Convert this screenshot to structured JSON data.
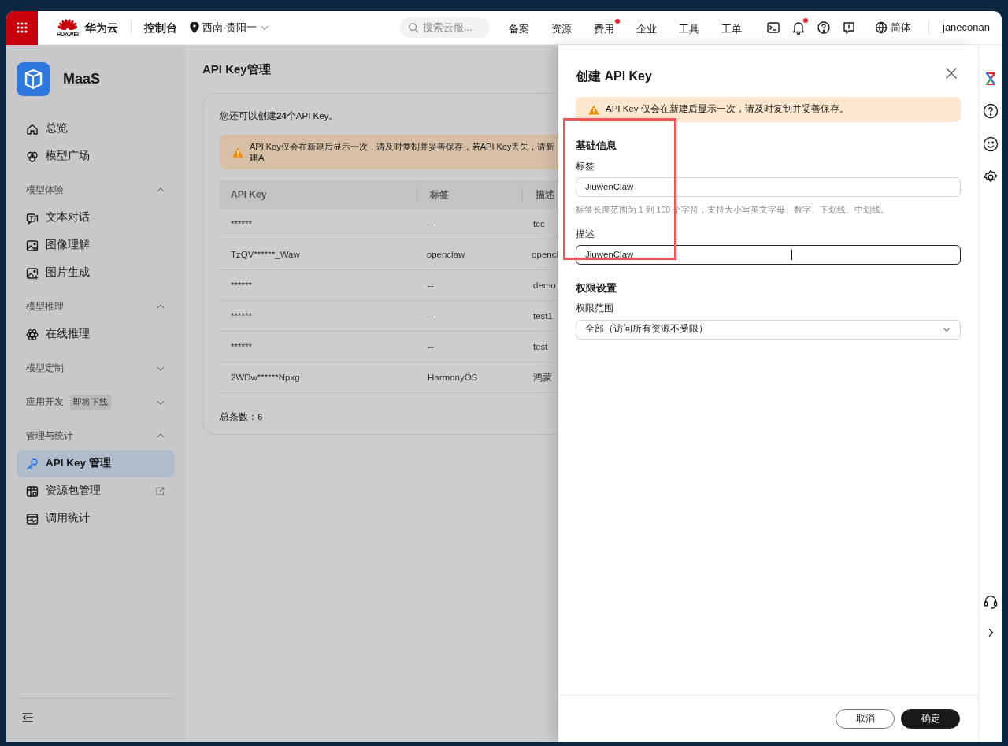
{
  "header": {
    "brand": "华为云",
    "brand_caption": "HUAWEI",
    "console": "控制台",
    "region": "西南-贵阳一",
    "search": {
      "placeholder": "搜索云服..."
    },
    "nav": [
      {
        "label": "备案",
        "dot": false
      },
      {
        "label": "资源",
        "dot": false
      },
      {
        "label": "费用",
        "dot": true
      },
      {
        "label": "企业",
        "dot": false
      },
      {
        "label": "工具",
        "dot": false
      },
      {
        "label": "工单",
        "dot": false
      }
    ],
    "icons": [
      {
        "kind": "terminal",
        "dot": false
      },
      {
        "kind": "bell",
        "dot": true
      },
      {
        "kind": "help",
        "dot": false
      },
      {
        "kind": "feedback",
        "dot": false
      }
    ],
    "language": "简体",
    "user": "janeconan"
  },
  "sidebar": {
    "product": "MaaS",
    "items": [
      {
        "label": "总览",
        "selected": false,
        "external": false
      },
      {
        "label": "模型广场",
        "selected": false,
        "external": false
      }
    ],
    "groups": [
      {
        "label": "模型体验",
        "expanded": true,
        "items": [
          {
            "label": "文本对话",
            "selected": false,
            "external": false
          },
          {
            "label": "图像理解",
            "selected": false,
            "external": false
          },
          {
            "label": "图片生成",
            "selected": false,
            "external": false
          }
        ]
      },
      {
        "label": "模型推理",
        "expanded": true,
        "items": [
          {
            "label": "在线推理",
            "selected": false,
            "external": false
          }
        ]
      },
      {
        "label": "模型定制",
        "expanded": false
      },
      {
        "label": "应用开发",
        "badge": "即将下线",
        "expanded": false
      },
      {
        "label": "管理与统计",
        "expanded": true,
        "items": [
          {
            "label": "API Key 管理",
            "selected": true,
            "external": false
          },
          {
            "label": "资源包管理",
            "selected": false,
            "external": true
          },
          {
            "label": "调用统计",
            "selected": false,
            "external": false
          }
        ]
      }
    ]
  },
  "page": {
    "title": "API Key管理",
    "quota": "您还可以创建**24**个API Key。",
    "warning": "API Key仅会在新建后显示一次，请及时复制并妥善保存，若API Key丢失，请新建A",
    "table": {
      "columns": [
        "API Key",
        "标签",
        "描述"
      ],
      "rows": [
        [
          "******",
          "--",
          "tcc"
        ],
        [
          "TzQV******_Waw",
          "openclaw",
          "opencl"
        ],
        [
          "******",
          "--",
          "demo"
        ],
        [
          "******",
          "--",
          "test1"
        ],
        [
          "******",
          "--",
          "test"
        ],
        [
          "2WDw******Npxg",
          "HarmonyOS",
          "鸿蒙"
        ]
      ]
    },
    "total": "总条数：6"
  },
  "drawer": {
    "title": "创建 API Key",
    "warning": "API Key 仅会在新建后显示一次，请及时复制并妥善保存。",
    "sections": [
      {
        "title": "基础信息",
        "highlighted": true,
        "fields": [
          {
            "kind": "input",
            "label": "标签",
            "value": "JiuwenClaw",
            "focused": false,
            "hint": "标签长度范围为 1 到 100 个字符，支持大小写英文字母、数字、下划线、中划线。"
          },
          {
            "kind": "input",
            "label": "描述",
            "value": "JiuwenClaw",
            "focused": true
          }
        ]
      },
      {
        "title": "权限设置",
        "highlighted": false,
        "fields": [
          {
            "kind": "select",
            "label": "权限范围",
            "value": "全部（访问所有资源不受限）",
            "focused": false
          }
        ]
      }
    ],
    "buttons": [
      {
        "label": "取消",
        "primary": false
      },
      {
        "label": "确定",
        "primary": true
      }
    ]
  }
}
